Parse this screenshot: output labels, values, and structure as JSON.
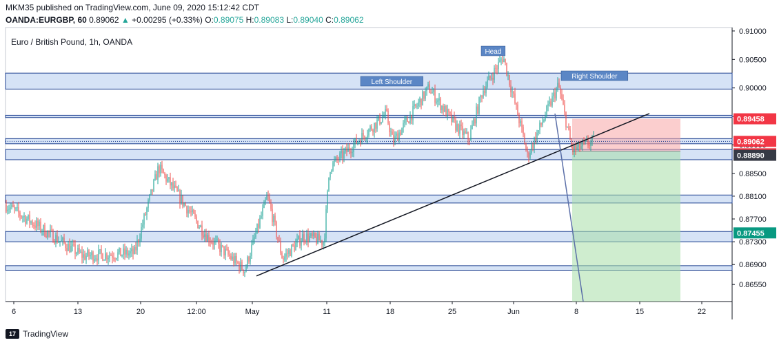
{
  "header": {
    "publisher_line": "MKM35 published on TradingView.com, June 09, 2020 15:12:42 CDT",
    "symbol": "OANDA:EURGBP, 60",
    "last": "0.89062",
    "change_arrow": "▲",
    "change": "+0.00295 (+0.33%)",
    "o_label": "O:",
    "o": "0.89075",
    "h_label": "H:",
    "h": "0.89083",
    "l_label": "L:",
    "l": "0.89040",
    "c_label": "C:",
    "c": "0.89062"
  },
  "footer": {
    "brand": "TradingView",
    "logo_text": "17"
  },
  "colors": {
    "up": "#26a69a",
    "down": "#ef5350",
    "zone_fill": "#d1e0f5",
    "zone_line": "#1c3f8f",
    "red_badge": "#f23645",
    "dark_badge": "#363a45",
    "green_badge": "#089981",
    "label_fill": "#5b86c5"
  },
  "chart_data": {
    "type": "candlestick",
    "title": "Euro / British Pound, 1h, OANDA",
    "x_ticks": [
      "6",
      "13",
      "20",
      "12:00",
      "May",
      "11",
      "18",
      "25",
      "Jun",
      "8",
      "15",
      "22"
    ],
    "y_ticks": [
      "0.91000",
      "0.90500",
      "0.90000",
      "0.89500",
      "0.89000",
      "0.88500",
      "0.88100",
      "0.87700",
      "0.87300",
      "0.86900",
      "0.86550"
    ],
    "ylim": [
      0.8625,
      0.9106
    ],
    "price_series": [
      [
        "6",
        0.8795
      ],
      [
        "13",
        0.8705
      ],
      [
        "20",
        0.871
      ],
      [
        "21",
        0.886
      ],
      [
        "12:00",
        0.874
      ],
      [
        "May",
        0.868
      ],
      [
        "May 4",
        0.881
      ],
      [
        "May 6",
        0.87
      ],
      [
        "11",
        0.874
      ],
      [
        "13",
        0.873
      ],
      [
        "14",
        0.886
      ],
      [
        "18",
        0.8955
      ],
      [
        "20",
        0.8905
      ],
      [
        "22",
        0.9
      ],
      [
        "25",
        0.8935
      ],
      [
        "26",
        0.891
      ],
      [
        "28",
        0.8995
      ],
      [
        "Jun 1",
        0.9055
      ],
      [
        "Jun 2",
        0.891
      ],
      [
        "Jun 4",
        0.888
      ],
      [
        "Jun 5",
        0.9005
      ],
      [
        "Jun 8",
        0.889
      ],
      [
        "Jun 9",
        0.8906
      ]
    ],
    "support_resistance_zones": [
      [
        0.8998,
        0.9026
      ],
      [
        0.8948,
        0.8952
      ],
      [
        0.8902,
        0.8911
      ],
      [
        0.8874,
        0.8892
      ],
      [
        0.8798,
        0.8812
      ],
      [
        0.873,
        0.8748
      ],
      [
        0.868,
        0.8688
      ]
    ],
    "annotations": {
      "head": "Head",
      "left_shoulder": "Left Shoulder",
      "right_shoulder": "Right Shoulder"
    },
    "price_badges": {
      "stop": "0.89458",
      "last": "0.89062",
      "countdown": "47:19",
      "entry": "0.88890",
      "target": "0.87455"
    },
    "trendline": {
      "from": [
        "May 1",
        0.867
      ],
      "to": [
        "Jun 11",
        0.8955
      ]
    },
    "position": {
      "entry": 0.8889,
      "stop": 0.89458,
      "target": 0.87455
    }
  }
}
